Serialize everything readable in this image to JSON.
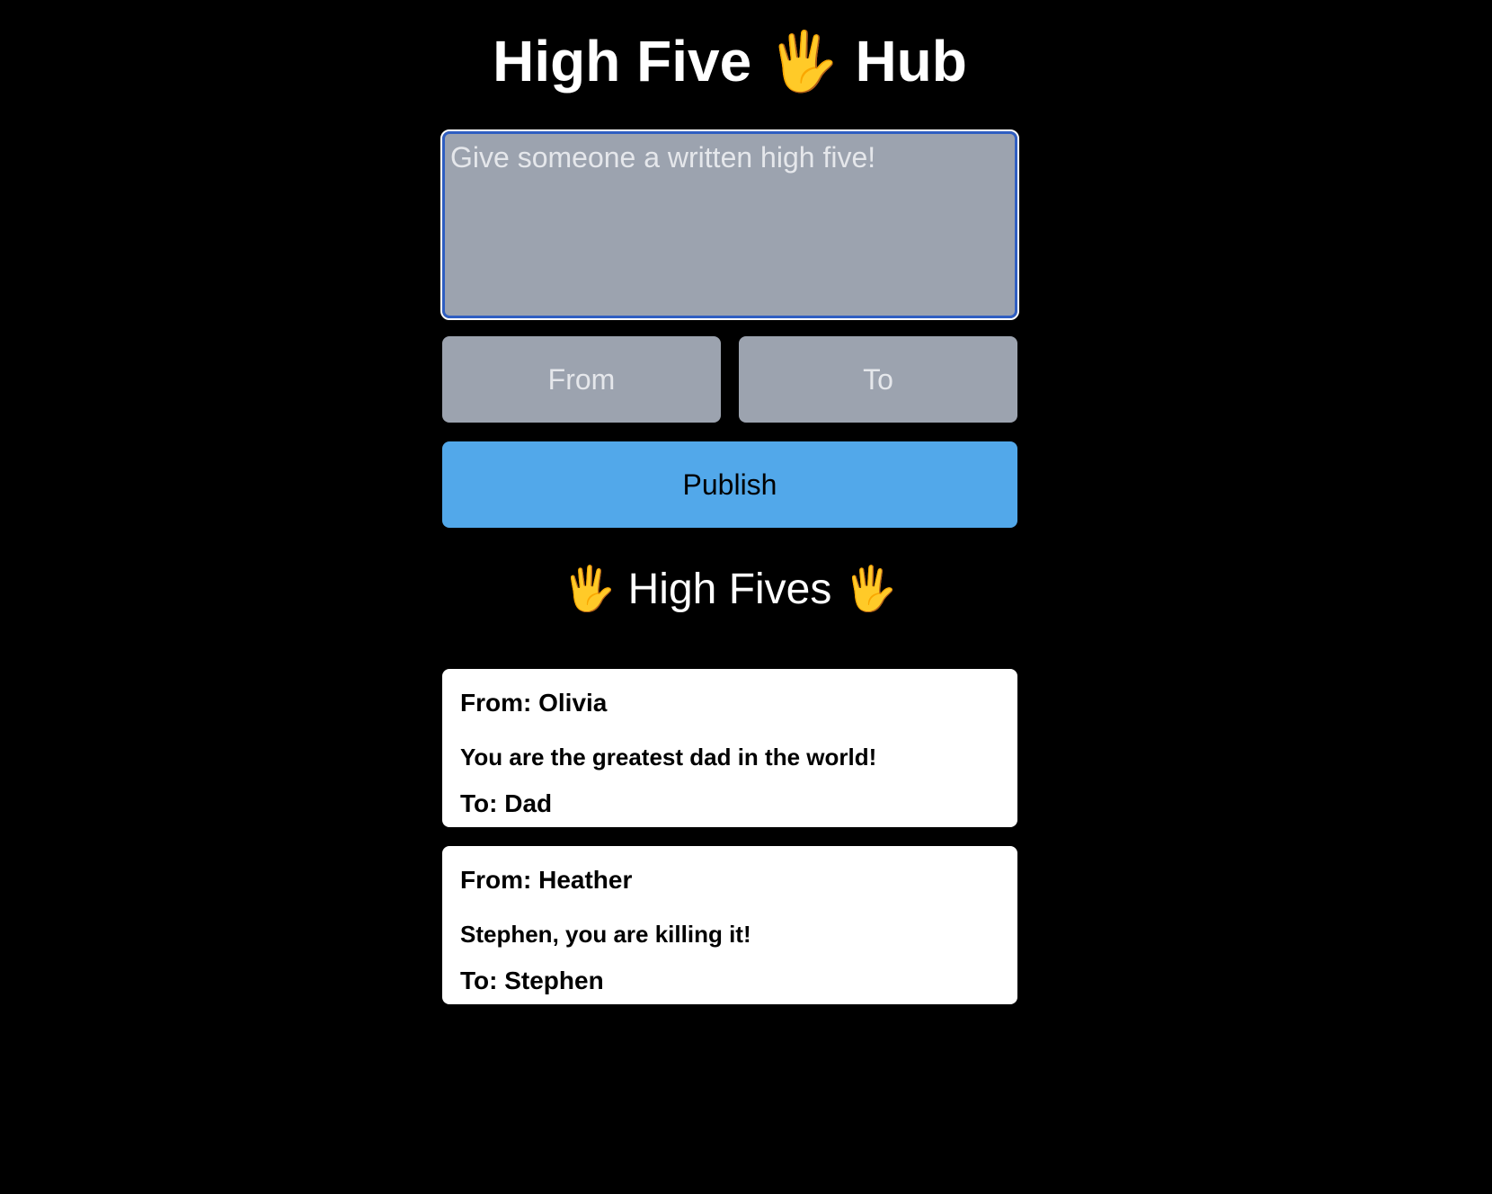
{
  "app": {
    "title": "High Five 🖐 Hub"
  },
  "form": {
    "message_placeholder": "Give someone a written high five!",
    "from_placeholder": "From",
    "to_placeholder": "To",
    "publish_label": "Publish"
  },
  "list": {
    "heading": "🖐 High Fives 🖐",
    "items": [
      {
        "from": "From: Olivia",
        "message": "You are the greatest dad in the world!",
        "to": "To: Dad"
      },
      {
        "from": "From: Heather",
        "message": "Stephen, you are killing it!",
        "to": "To: Stephen"
      }
    ]
  },
  "colors": {
    "background": "#000000",
    "input_bg": "#9ca3af",
    "focus_border": "#2f5ec2",
    "publish_button": "#52a8ea",
    "card_bg": "#ffffff"
  }
}
